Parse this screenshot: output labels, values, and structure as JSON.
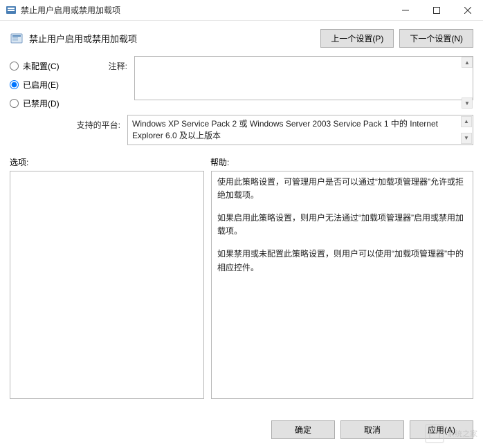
{
  "window": {
    "title": "禁止用户启用或禁用加载项"
  },
  "header": {
    "policy_title": "禁止用户启用或禁用加载项",
    "prev_btn": "上一个设置(P)",
    "next_btn": "下一个设置(N)"
  },
  "radios": {
    "not_configured": "未配置(C)",
    "enabled": "已启用(E)",
    "disabled": "已禁用(D)",
    "selected": "enabled"
  },
  "labels": {
    "comment": "注释:",
    "platform": "支持的平台:",
    "options": "选项:",
    "help": "帮助:"
  },
  "comment_text": "",
  "platform_text": "Windows XP Service Pack 2 或 Windows Server 2003 Service Pack 1 中的 Internet Explorer 6.0 及以上版本",
  "help_paragraphs": [
    "使用此策略设置，可管理用户是否可以通过“加载项管理器”允许或拒绝加载项。",
    "如果启用此策略设置，则用户无法通过“加载项管理器”启用或禁用加载项。",
    "如果禁用或未配置此策略设置，则用户可以使用“加载项管理器”中的相应控件。"
  ],
  "footer": {
    "ok": "确定",
    "cancel": "取消",
    "apply": "应用(A)"
  },
  "watermark": {
    "text": "系统之家"
  }
}
